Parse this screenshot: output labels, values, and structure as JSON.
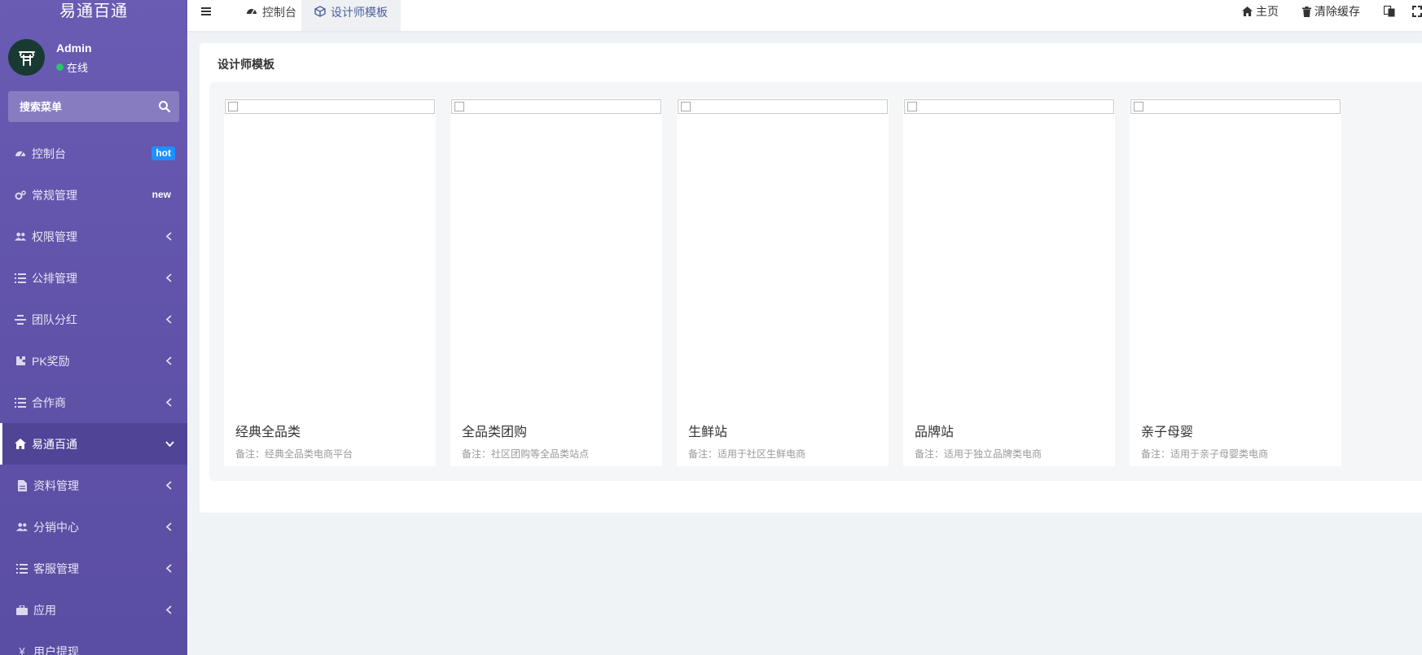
{
  "sidebar": {
    "brand": "易通百通",
    "user": {
      "name": "Admin",
      "status": "在线"
    },
    "search": {
      "placeholder": "搜索菜单"
    },
    "items": [
      {
        "label": "控制台",
        "icon": "dashboard-icon",
        "badge": "hot"
      },
      {
        "label": "常规管理",
        "icon": "cogs-icon",
        "badge": "new"
      },
      {
        "label": "权限管理",
        "icon": "users-icon"
      },
      {
        "label": "公排管理",
        "icon": "list-icon"
      },
      {
        "label": "团队分红",
        "icon": "align-icon"
      },
      {
        "label": "PK奖励",
        "icon": "puzzle-icon"
      },
      {
        "label": "合作商",
        "icon": "list-icon"
      },
      {
        "label": "易通百通",
        "icon": "home-icon",
        "active": true
      },
      {
        "label": "资料管理",
        "icon": "file-icon"
      },
      {
        "label": "分销中心",
        "icon": "users-icon"
      },
      {
        "label": "客服管理",
        "icon": "list-icon"
      },
      {
        "label": "应用",
        "icon": "briefcase-icon"
      },
      {
        "label": "用户提现",
        "icon": "yen-icon"
      }
    ]
  },
  "header": {
    "tabs": [
      {
        "label": "控制台",
        "icon": "dashboard-icon"
      },
      {
        "label": "设计师模板",
        "icon": "cube-icon",
        "active": true
      }
    ],
    "right": {
      "home": "主页",
      "clear_cache": "清除缓存"
    }
  },
  "content": {
    "title": "设计师模板",
    "cards": [
      {
        "title": "经典全品类",
        "note": "备注：经典全品类电商平台"
      },
      {
        "title": "全品类团购",
        "note": "备注：社区团购等全品类站点"
      },
      {
        "title": "生鲜站",
        "note": "备注：适用于社区生鲜电商"
      },
      {
        "title": "品牌站",
        "note": "备注：适用于独立品牌类电商"
      },
      {
        "title": "亲子母婴",
        "note": "备注：适用于亲子母婴类电商"
      }
    ]
  },
  "colors": {
    "sidebar": "#6a5bb3",
    "active_item": "#4f4496",
    "hot_badge": "#1e90ff",
    "online": "#2fc26d",
    "active_tab_text": "#4a5f9e"
  }
}
